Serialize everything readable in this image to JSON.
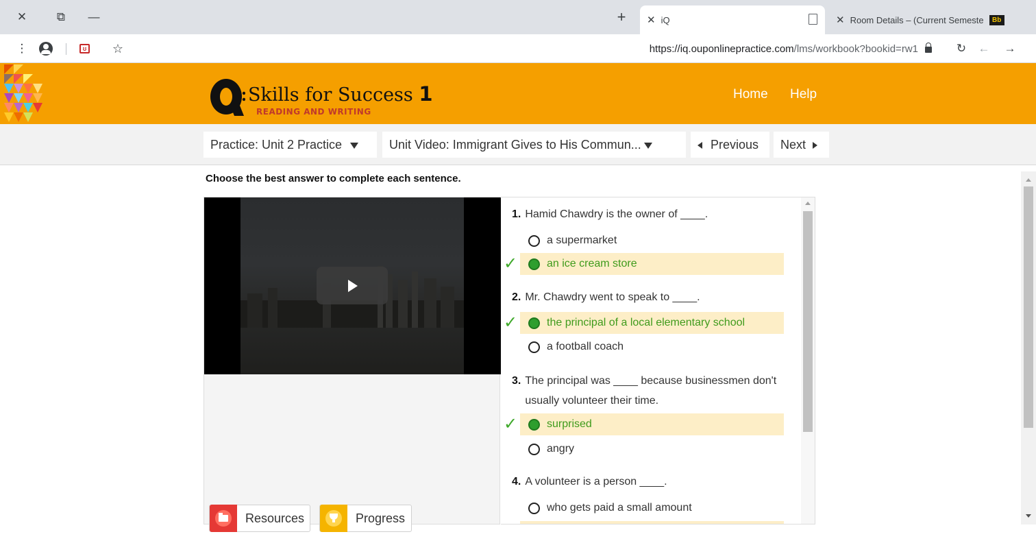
{
  "browser": {
    "tabs": [
      {
        "title": "iQ",
        "active": true
      },
      {
        "title": "Room Details – (Current Semeste",
        "active": false,
        "favicon_text": "Bb"
      }
    ],
    "url_host": "https://iq.ouponlinepractice.com",
    "url_path": "/lms/workbook?bookid=rw1",
    "icons": [
      "close-icon",
      "restore-icon",
      "minimize-icon",
      "new-tab-icon",
      "menu-icon",
      "account-icon",
      "extension-icon",
      "star-icon",
      "lock-icon",
      "reload-icon",
      "back-icon",
      "forward-icon"
    ]
  },
  "header": {
    "brand_title": "Skills for Success",
    "brand_level": "1",
    "brand_subtitle": "READING AND WRITING",
    "nav": {
      "home": "Home",
      "help": "Help"
    },
    "colors": {
      "header_bg": "#f59f00"
    }
  },
  "navbar": {
    "practice_select": "Practice: Unit 2 Practice",
    "activity_select": "Unit Video: Immigrant Gives to His Commun...",
    "previous_label": "Previous",
    "next_label": "Next"
  },
  "instructions": "Choose the best answer to complete each sentence.",
  "tools": {
    "resources_label": "Resources",
    "progress_label": "Progress"
  },
  "questions": [
    {
      "number": "1.",
      "text": "Hamid Chawdry is the owner of ____.",
      "options": [
        {
          "text": "a supermarket",
          "correct": false
        },
        {
          "text": "an ice cream store",
          "correct": true
        }
      ]
    },
    {
      "number": "2.",
      "text": "Mr. Chawdry went to speak to ____.",
      "options": [
        {
          "text": "the principal of a local elementary school",
          "correct": true
        },
        {
          "text": "a football coach",
          "correct": false
        }
      ]
    },
    {
      "number": "3.",
      "text": "The principal was ____ because businessmen don't usually volunteer their time.",
      "options": [
        {
          "text": "surprised",
          "correct": true
        },
        {
          "text": "angry",
          "correct": false
        }
      ]
    },
    {
      "number": "4.",
      "text": "A volunteer is a person ____.",
      "options": [
        {
          "text": "who gets paid a small amount",
          "correct": false
        }
      ]
    }
  ],
  "colors": {
    "correct_highlight": "#fdeec7",
    "correct_text": "#3f9b1c"
  }
}
